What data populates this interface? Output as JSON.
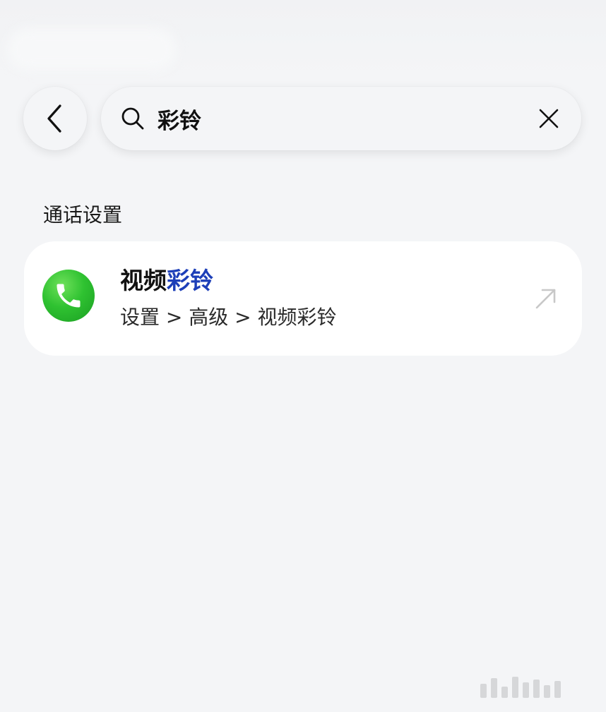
{
  "header": {
    "back_icon": "chevron-left-icon",
    "search": {
      "icon": "search-icon",
      "value": "彩铃",
      "clear_icon": "close-icon"
    }
  },
  "section": {
    "title": "通话设置"
  },
  "results": [
    {
      "icon": "phone-icon",
      "title_plain": "视频",
      "title_highlight": "彩铃",
      "path": "设置 > 高级 > 视频彩铃",
      "action_icon": "arrow-up-right-icon"
    }
  ],
  "colors": {
    "background": "#f4f5f7",
    "card": "#ffffff",
    "highlight": "#1d3fb8",
    "phone_icon_green": "#2fc231"
  }
}
